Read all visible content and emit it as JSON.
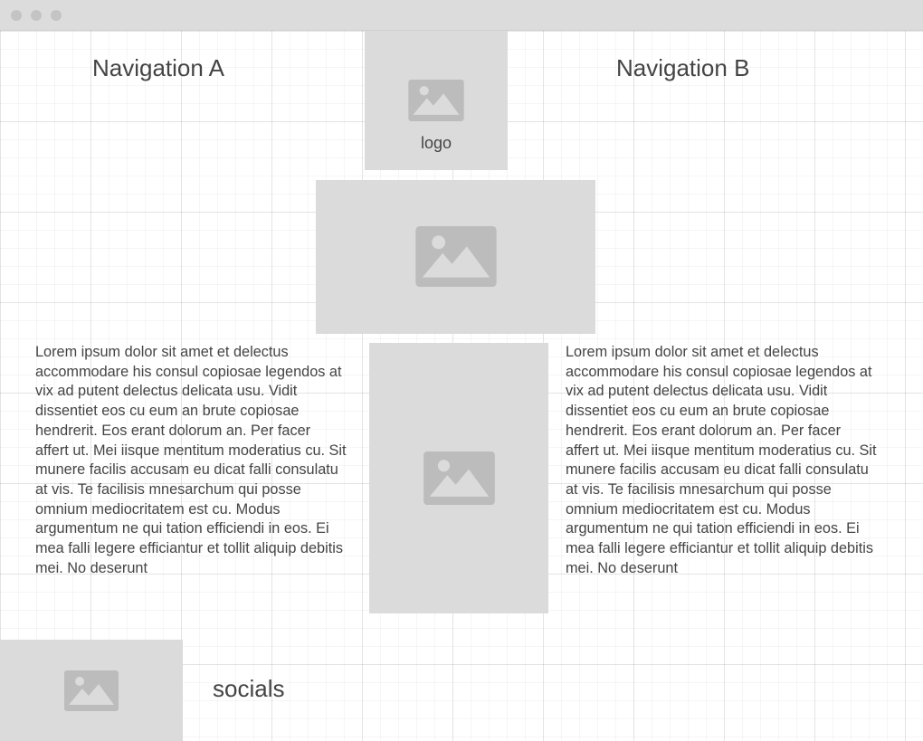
{
  "window": {
    "controls": [
      "close",
      "minimize",
      "maximize"
    ]
  },
  "header": {
    "nav_a": "Navigation A",
    "nav_b": "Navigation B",
    "logo_label": "logo"
  },
  "content": {
    "left_text": "Lorem ipsum dolor sit amet et delectus accommodare his consul copiosae legendos at vix ad putent delectus delicata usu. Vidit dissentiet eos cu eum an brute copiosae hendrerit. Eos erant dolorum an. Per facer affert ut. Mei iisque mentitum moderatius cu. Sit munere facilis accusam eu dicat falli consulatu at vis. Te facilisis mnesarchum qui posse omnium mediocritatem est cu. Modus argumentum ne qui tation efficiendi in eos. Ei mea falli legere efficiantur et tollit aliquip debitis mei. No deserunt",
    "right_text": "Lorem ipsum dolor sit amet et delectus accommodare his consul copiosae legendos at vix ad putent delectus delicata usu. Vidit dissentiet eos cu eum an brute copiosae hendrerit. Eos erant dolorum an. Per facer affert ut. Mei iisque mentitum moderatius cu. Sit munere facilis accusam eu dicat falli consulatu at vis. Te facilisis mnesarchum qui posse omnium mediocritatem est cu. Modus argumentum ne qui tation efficiendi in eos. Ei mea falli legere efficiantur et tollit aliquip debitis mei. No deserunt"
  },
  "footer": {
    "socials_label": "socials"
  },
  "icons": {
    "placeholder": "image-placeholder-icon"
  },
  "colors": {
    "placeholder_bg": "#dbdbdb",
    "icon": "#bcbcbc",
    "text": "#444444",
    "titlebar": "#dcdcdc"
  }
}
